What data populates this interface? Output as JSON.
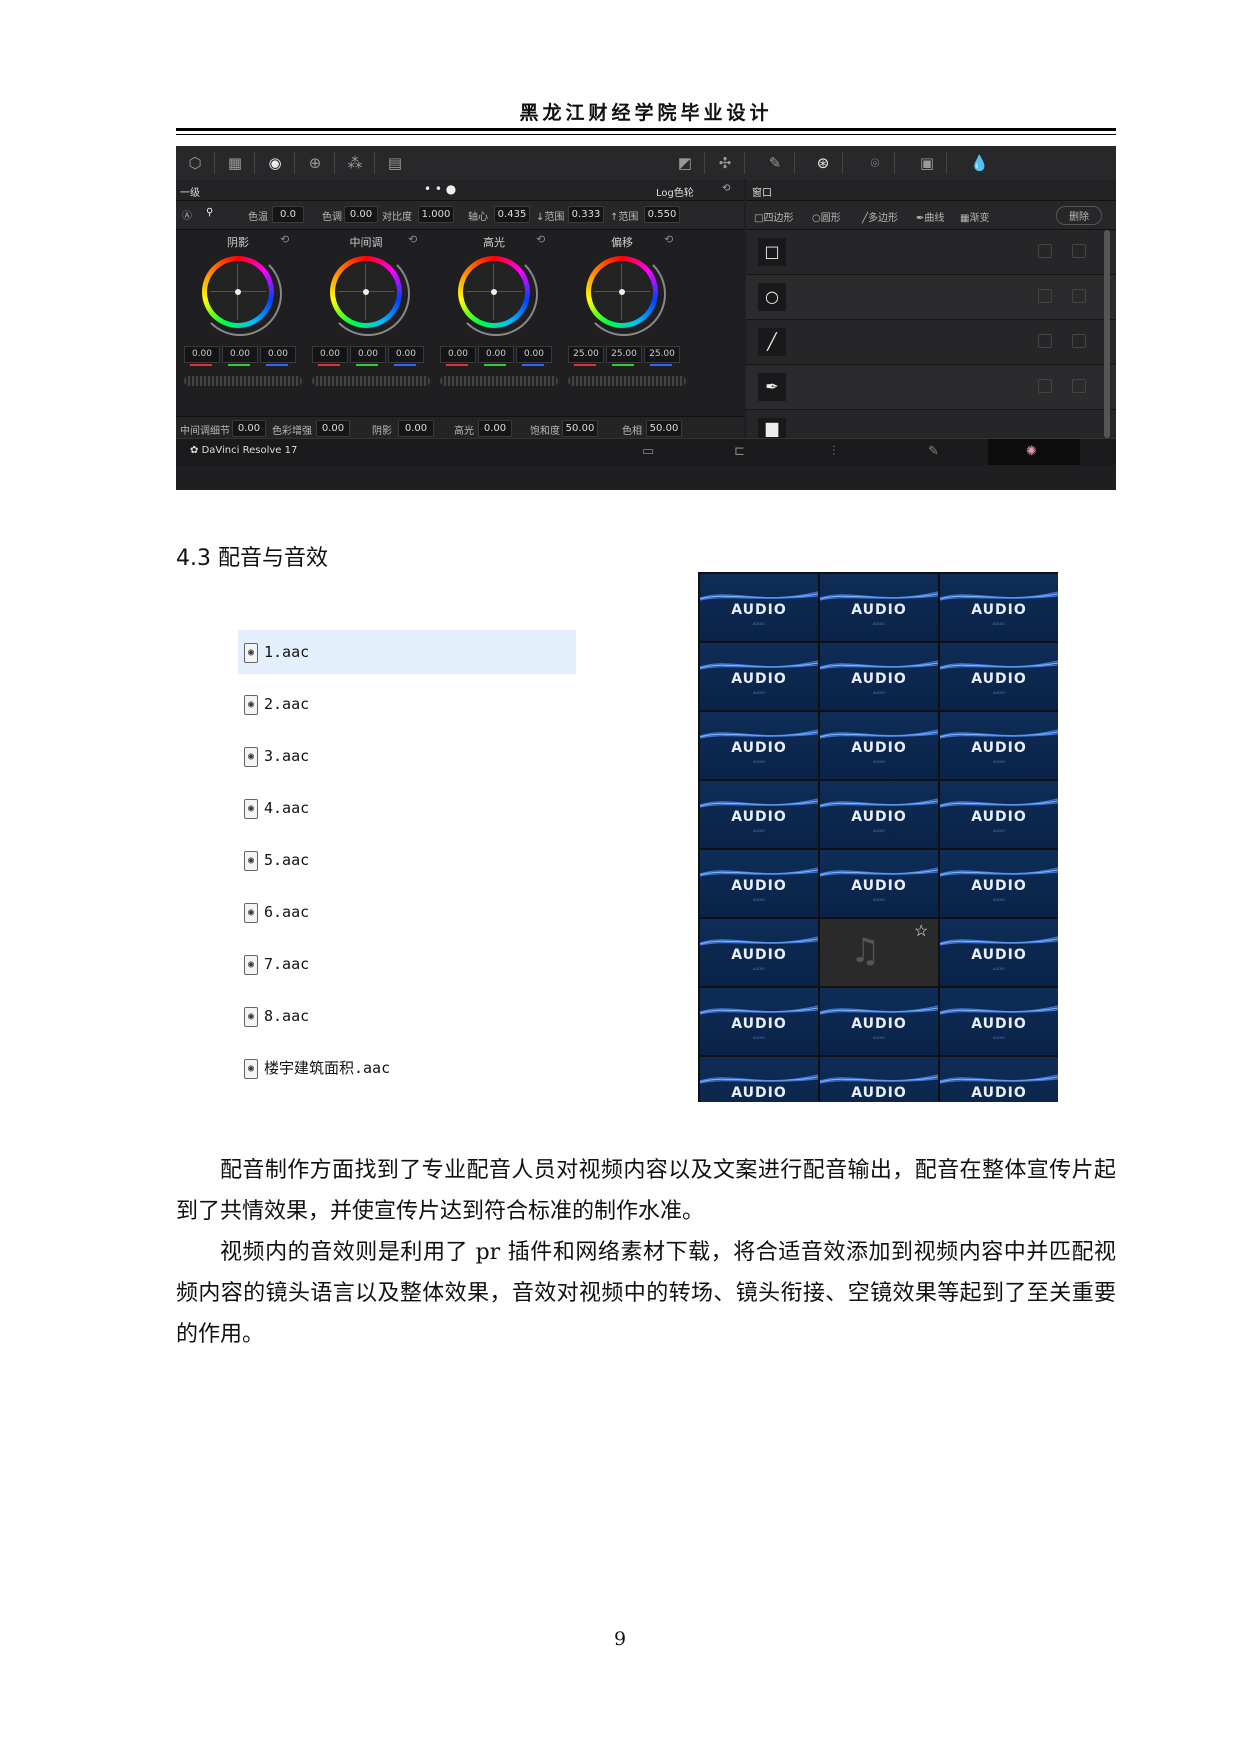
{
  "header": {
    "title": "黑龙江财经学院毕业设计"
  },
  "resolve": {
    "node_label": "一级",
    "mode_label": "Log色轮",
    "window_label": "窗口",
    "params": [
      {
        "label": "色温",
        "value": "0.0"
      },
      {
        "label": "色调",
        "value": "0.00"
      },
      {
        "label": "对比度",
        "value": "1.000"
      },
      {
        "label": "轴心",
        "value": "0.435"
      },
      {
        "label": "↓范围",
        "value": "0.333"
      },
      {
        "label": "↑范围",
        "value": "0.550"
      }
    ],
    "window_tools": [
      "四边形",
      "圆形",
      "多边形",
      "曲线",
      "渐变"
    ],
    "delete_label": "删除",
    "wheels": [
      {
        "title": "阴影",
        "values": [
          "0.00",
          "0.00",
          "0.00"
        ]
      },
      {
        "title": "中间调",
        "values": [
          "0.00",
          "0.00",
          "0.00"
        ]
      },
      {
        "title": "高光",
        "values": [
          "0.00",
          "0.00",
          "0.00"
        ]
      },
      {
        "title": "偏移",
        "values": [
          "25.00",
          "25.00",
          "25.00"
        ]
      }
    ],
    "bottom_params": [
      {
        "label": "中间调细节",
        "value": "0.00"
      },
      {
        "label": "色彩增强",
        "value": "0.00"
      },
      {
        "label": "阴影",
        "value": "0.00"
      },
      {
        "label": "高光",
        "value": "0.00"
      },
      {
        "label": "饱和度",
        "value": "50.00"
      },
      {
        "label": "色相",
        "value": "50.00"
      }
    ],
    "app_name": "DaVinci Resolve 17"
  },
  "section": {
    "heading": "4.3  配音与音效"
  },
  "files": [
    "1.aac",
    "2.aac",
    "3.aac",
    "4.aac",
    "5.aac",
    "6.aac",
    "7.aac",
    "8.aac",
    "楼宇建筑面积.aac"
  ],
  "audio_tile": {
    "label": "AUDIO",
    "sub": "ᴬᵁᴰᴵᴼ",
    "special_icon": "music-note-icon"
  },
  "paragraphs": [
    "配音制作方面找到了专业配音人员对视频内容以及文案进行配音输出，配音在整体宣传片起到了共情效果，并使宣传片达到符合标准的制作水准。",
    "视频内的音效则是利用了 pr 插件和网络素材下载，将合适音效添加到视频内容中并匹配视频内容的镜头语言以及整体效果，音效对视频中的转场、镜头衔接、空镜效果等起到了至关重要的作用。"
  ],
  "page_number": "9"
}
